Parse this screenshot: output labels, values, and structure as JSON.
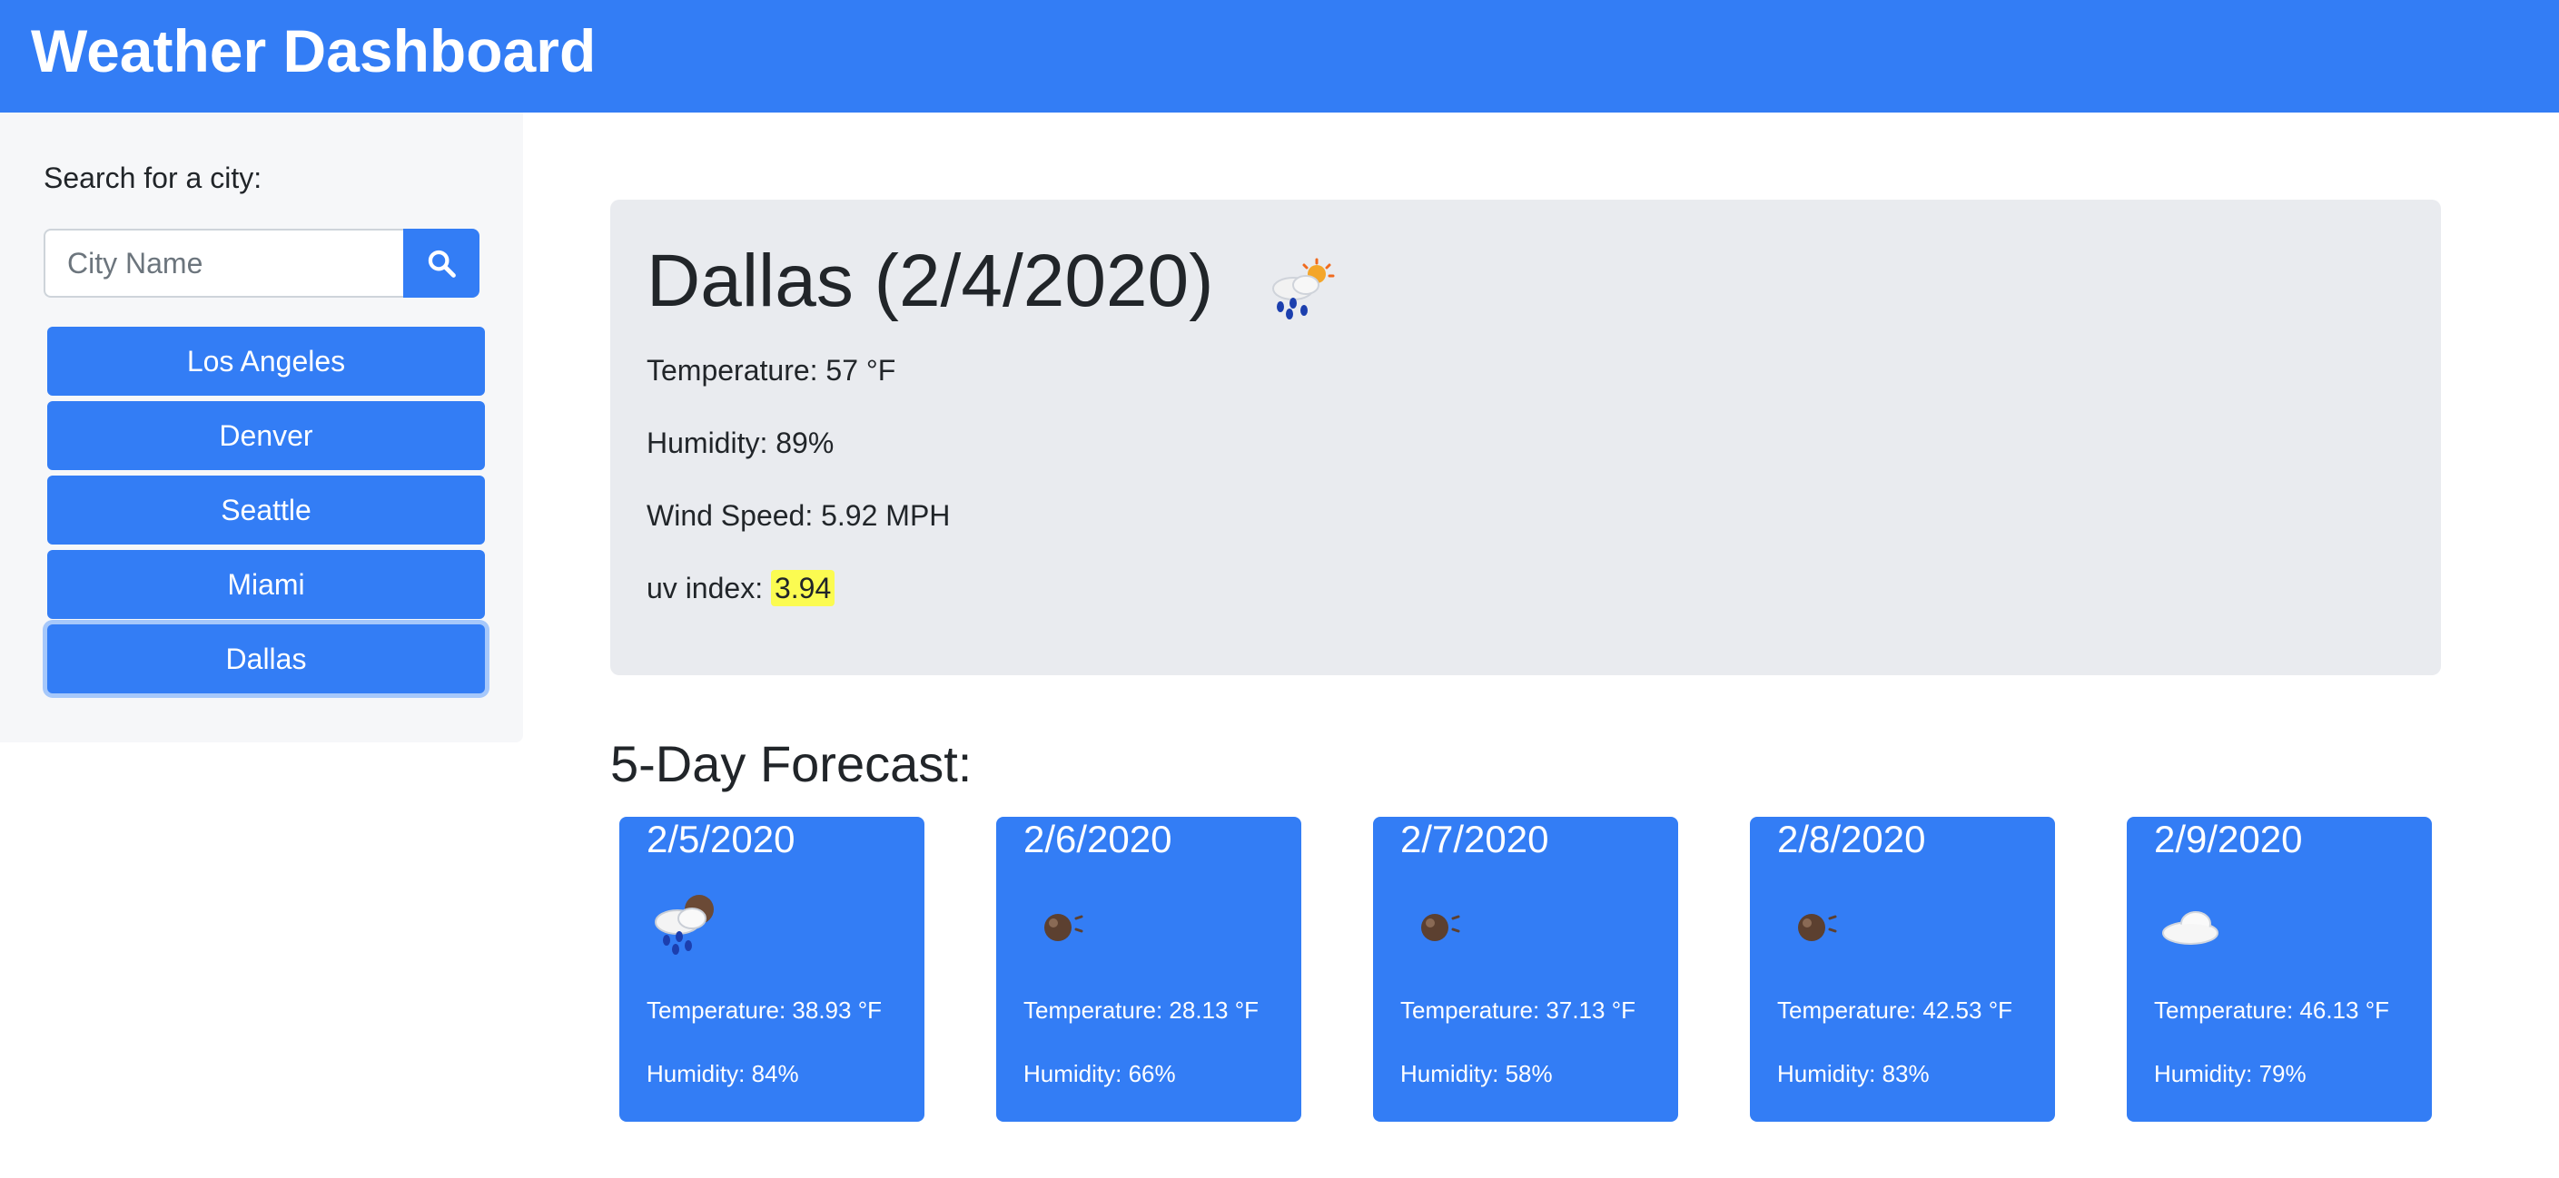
{
  "header": {
    "title": "Weather Dashboard"
  },
  "sidebar": {
    "search_label": "Search for a city:",
    "search_placeholder": "City Name",
    "search_value": "",
    "cities": [
      "Los Angeles",
      "Denver",
      "Seattle",
      "Miami",
      "Dallas"
    ],
    "active_city": "Dallas"
  },
  "current": {
    "title": "Dallas (2/4/2020)",
    "icon": "rain-sun-icon",
    "temperature_label": "Temperature: 57 °F",
    "humidity_label": "Humidity: 89%",
    "wind_label": "Wind Speed: 5.92 MPH",
    "uv_label": "uv index: ",
    "uv_value": "3.94",
    "uv_color": "#fbfb51"
  },
  "forecast": {
    "heading": "5-Day Forecast:",
    "days": [
      {
        "date": "2/5/2020",
        "icon": "rain-cloud-icon",
        "temperature": "Temperature: 38.93 °F",
        "humidity": "Humidity: 84%"
      },
      {
        "date": "2/6/2020",
        "icon": "clear-night-icon",
        "temperature": "Temperature: 28.13 °F",
        "humidity": "Humidity: 66%"
      },
      {
        "date": "2/7/2020",
        "icon": "clear-night-icon",
        "temperature": "Temperature: 37.13 °F",
        "humidity": "Humidity: 58%"
      },
      {
        "date": "2/8/2020",
        "icon": "clear-night-icon",
        "temperature": "Temperature: 42.53 °F",
        "humidity": "Humidity: 83%"
      },
      {
        "date": "2/9/2020",
        "icon": "cloud-icon",
        "temperature": "Temperature: 46.13 °F",
        "humidity": "Humidity: 79%"
      }
    ]
  },
  "colors": {
    "primary": "#337df5",
    "panel": "#e9ebef",
    "sidebar": "#f6f7f9",
    "uv_highlight": "#fbfb51"
  }
}
